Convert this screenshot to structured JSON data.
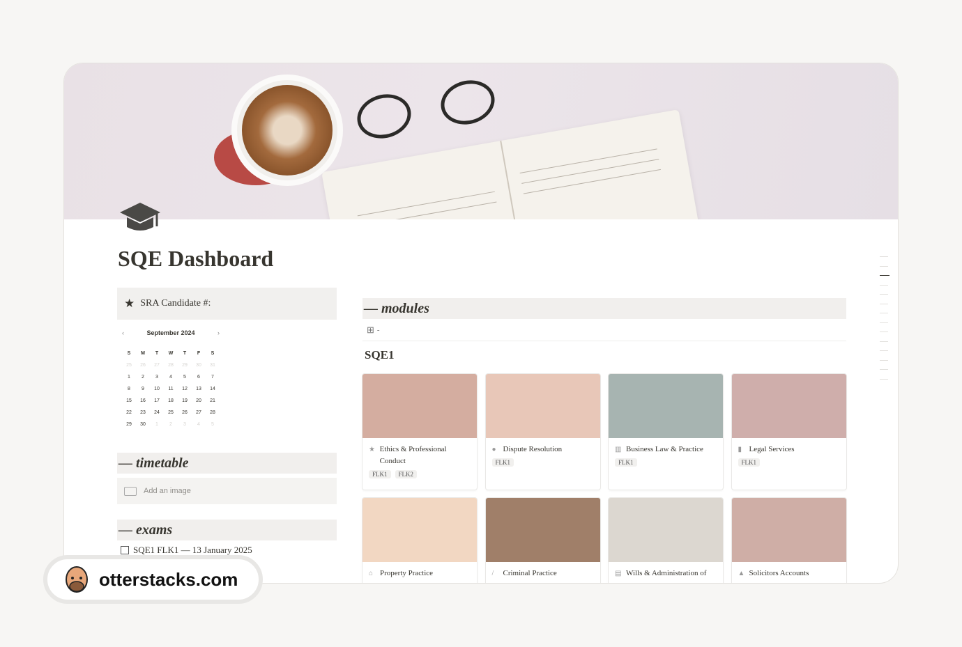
{
  "page": {
    "title": "SQE Dashboard",
    "icon": "graduation-cap-icon"
  },
  "callout": {
    "icon": "star-icon",
    "text": "SRA Candidate #:"
  },
  "calendar": {
    "month": "September 2024",
    "prev": "‹",
    "next": "›",
    "weekdays": [
      "S",
      "M",
      "T",
      "W",
      "T",
      "F",
      "S"
    ],
    "days": [
      [
        "25",
        "o"
      ],
      [
        "26",
        "o"
      ],
      [
        "27",
        "o"
      ],
      [
        "28",
        "o"
      ],
      [
        "29",
        "o"
      ],
      [
        "30",
        "o"
      ],
      [
        "31",
        "o"
      ],
      [
        "1",
        ""
      ],
      [
        "2",
        ""
      ],
      [
        "3",
        ""
      ],
      [
        "4",
        ""
      ],
      [
        "5",
        ""
      ],
      [
        "6",
        ""
      ],
      [
        "7",
        ""
      ],
      [
        "8",
        ""
      ],
      [
        "9",
        ""
      ],
      [
        "10",
        ""
      ],
      [
        "11",
        ""
      ],
      [
        "12",
        ""
      ],
      [
        "13",
        ""
      ],
      [
        "14",
        ""
      ],
      [
        "15",
        ""
      ],
      [
        "16",
        ""
      ],
      [
        "17",
        ""
      ],
      [
        "18",
        ""
      ],
      [
        "19",
        ""
      ],
      [
        "20",
        ""
      ],
      [
        "21",
        ""
      ],
      [
        "22",
        ""
      ],
      [
        "23",
        ""
      ],
      [
        "24",
        ""
      ],
      [
        "25",
        ""
      ],
      [
        "26",
        ""
      ],
      [
        "27",
        ""
      ],
      [
        "28",
        ""
      ],
      [
        "29",
        ""
      ],
      [
        "30",
        ""
      ],
      [
        "1",
        "o"
      ],
      [
        "2",
        "o"
      ],
      [
        "3",
        "o"
      ],
      [
        "4",
        "o"
      ],
      [
        "5",
        "o"
      ]
    ]
  },
  "timetable": {
    "heading": "— timetable",
    "add_image": "Add an image"
  },
  "exams": {
    "heading": "— exams",
    "items": [
      {
        "text": "SQE1 FLK1 — 13 January 2025",
        "checked": false
      }
    ]
  },
  "modules": {
    "heading": "— modules",
    "view_label": "-",
    "group": "SQE1",
    "cards": [
      {
        "title": "Ethics & Professional Conduct",
        "icon": "star-icon",
        "glyph": "★",
        "color": "#d4ada0",
        "tags": [
          "FLK1",
          "FLK2"
        ]
      },
      {
        "title": "Dispute Resolution",
        "icon": "check-badge-icon",
        "glyph": "●",
        "color": "#e8c7b8",
        "tags": [
          "FLK1"
        ]
      },
      {
        "title": "Business Law & Practice",
        "icon": "bar-chart-icon",
        "glyph": "▥",
        "color": "#a7b4b1",
        "tags": [
          "FLK1"
        ]
      },
      {
        "title": "Legal Services",
        "icon": "bookmark-icon",
        "glyph": "▮",
        "color": "#cfaeab",
        "tags": [
          "FLK1"
        ]
      },
      {
        "title": "Property Practice",
        "icon": "house-icon",
        "glyph": "⌂",
        "color": "#f2d7c2",
        "tags": []
      },
      {
        "title": "Criminal Practice",
        "icon": "pen-icon",
        "glyph": "/",
        "color": "#a07f69",
        "tags": []
      },
      {
        "title": "Wills & Administration of",
        "icon": "document-icon",
        "glyph": "▤",
        "color": "#dcd7d0",
        "tags": []
      },
      {
        "title": "Solicitors Accounts",
        "icon": "lock-icon",
        "glyph": "▲",
        "color": "#cfaea6",
        "tags": []
      }
    ]
  },
  "watermark": {
    "text": "otterstacks.com"
  }
}
